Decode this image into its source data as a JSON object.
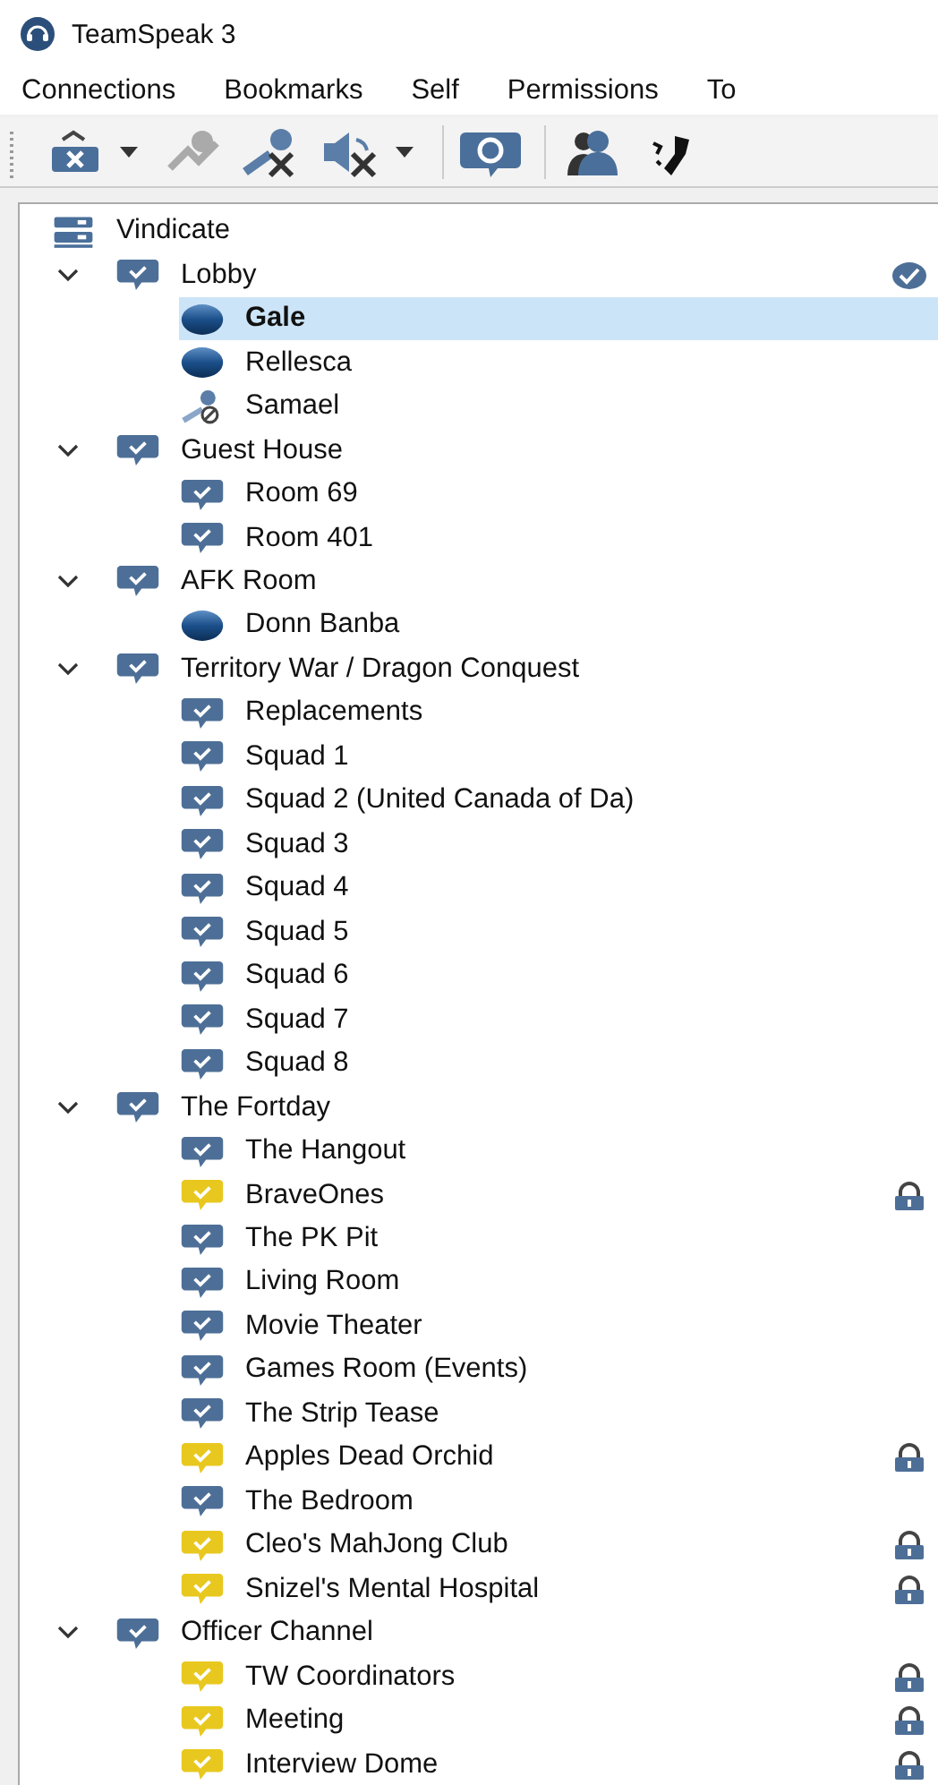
{
  "window": {
    "title": "TeamSpeak 3"
  },
  "menu": [
    "Connections",
    "Bookmarks",
    "Self",
    "Permissions",
    "To"
  ],
  "server": {
    "name": "Vindicate",
    "selected": false,
    "channels": [
      {
        "kind": "channel",
        "name": "Lobby",
        "selected": false,
        "expanded": true,
        "default": true,
        "locked": false,
        "children": [
          {
            "kind": "client",
            "name": "Gale",
            "selected": true,
            "muted": false
          },
          {
            "kind": "client",
            "name": "Rellesca",
            "selected": false,
            "muted": false
          },
          {
            "kind": "client",
            "name": "Samael",
            "selected": false,
            "muted": true
          }
        ]
      },
      {
        "kind": "channel",
        "name": "Guest House",
        "selected": false,
        "expanded": true,
        "default": false,
        "locked": false,
        "children": [
          {
            "kind": "channel",
            "name": "Room 69",
            "selected": false,
            "default": false,
            "locked": false
          },
          {
            "kind": "channel",
            "name": "Room 401",
            "selected": false,
            "default": false,
            "locked": false
          }
        ]
      },
      {
        "kind": "channel",
        "name": "AFK Room",
        "selected": false,
        "expanded": true,
        "default": false,
        "locked": false,
        "children": [
          {
            "kind": "client",
            "name": "Donn Banba",
            "selected": false,
            "muted": false
          }
        ]
      },
      {
        "kind": "channel",
        "name": "Territory War / Dragon Conquest",
        "selected": false,
        "expanded": true,
        "default": false,
        "locked": false,
        "children": [
          {
            "kind": "channel",
            "name": "Replacements",
            "selected": false,
            "default": false,
            "locked": false
          },
          {
            "kind": "channel",
            "name": "Squad 1",
            "selected": false,
            "default": false,
            "locked": false
          },
          {
            "kind": "channel",
            "name": "Squad 2 (United Canada of Da)",
            "selected": false,
            "default": false,
            "locked": false
          },
          {
            "kind": "channel",
            "name": "Squad 3",
            "selected": false,
            "default": false,
            "locked": false
          },
          {
            "kind": "channel",
            "name": "Squad 4",
            "selected": false,
            "default": false,
            "locked": false
          },
          {
            "kind": "channel",
            "name": "Squad 5",
            "selected": false,
            "default": false,
            "locked": false
          },
          {
            "kind": "channel",
            "name": "Squad 6",
            "selected": false,
            "default": false,
            "locked": false
          },
          {
            "kind": "channel",
            "name": "Squad 7",
            "selected": false,
            "default": false,
            "locked": false
          },
          {
            "kind": "channel",
            "name": "Squad 8",
            "selected": false,
            "default": false,
            "locked": false
          }
        ]
      },
      {
        "kind": "channel",
        "name": "The Fortday",
        "selected": false,
        "expanded": true,
        "default": false,
        "locked": false,
        "children": [
          {
            "kind": "channel",
            "name": "The Hangout",
            "selected": false,
            "default": false,
            "locked": false
          },
          {
            "kind": "channel",
            "name": "BraveOnes",
            "selected": false,
            "default": false,
            "locked": true
          },
          {
            "kind": "channel",
            "name": "The PK Pit",
            "selected": false,
            "default": false,
            "locked": false
          },
          {
            "kind": "channel",
            "name": "Living Room",
            "selected": false,
            "default": false,
            "locked": false
          },
          {
            "kind": "channel",
            "name": "Movie Theater",
            "selected": false,
            "default": false,
            "locked": false
          },
          {
            "kind": "channel",
            "name": "Games Room (Events)",
            "selected": false,
            "default": false,
            "locked": false
          },
          {
            "kind": "channel",
            "name": "The Strip Tease",
            "selected": false,
            "default": false,
            "locked": false
          },
          {
            "kind": "channel",
            "name": "Apples Dead Orchid",
            "selected": false,
            "default": false,
            "locked": true
          },
          {
            "kind": "channel",
            "name": "The Bedroom",
            "selected": false,
            "default": false,
            "locked": false
          },
          {
            "kind": "channel",
            "name": "Cleo's MahJong Club",
            "selected": false,
            "default": false,
            "locked": true
          },
          {
            "kind": "channel",
            "name": "Snizel's Mental Hospital",
            "selected": false,
            "default": false,
            "locked": true
          }
        ]
      },
      {
        "kind": "channel",
        "name": "Officer Channel",
        "selected": false,
        "expanded": true,
        "default": false,
        "locked": false,
        "children": [
          {
            "kind": "channel",
            "name": "TW Coordinators",
            "selected": false,
            "default": false,
            "locked": true
          },
          {
            "kind": "channel",
            "name": "Meeting",
            "selected": false,
            "default": false,
            "locked": true
          },
          {
            "kind": "channel",
            "name": "Interview Dome",
            "selected": false,
            "default": false,
            "locked": true
          }
        ]
      }
    ]
  }
}
